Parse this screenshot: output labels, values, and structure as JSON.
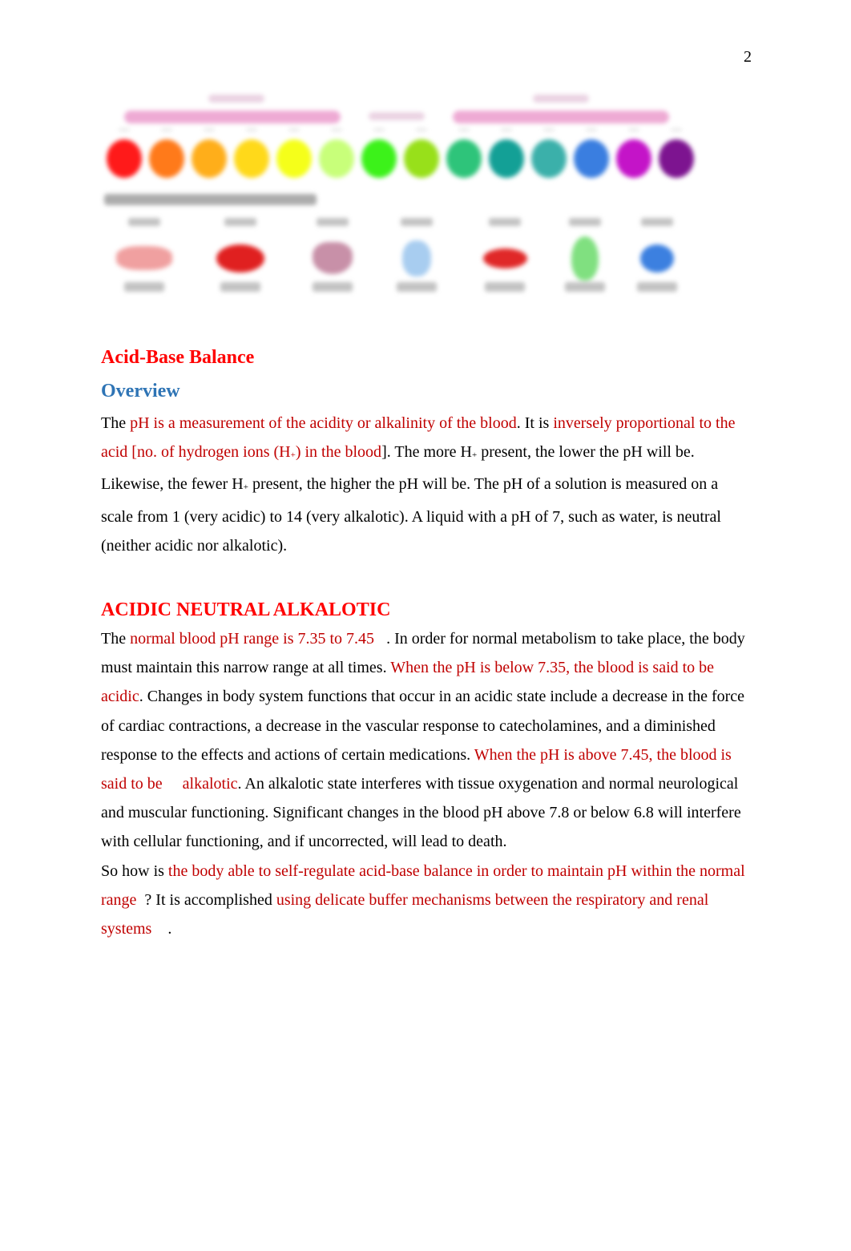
{
  "page_number": "2",
  "figure": {
    "description": "blurred pH scale figure with colored indicator circles and example substances",
    "scale_colors": [
      "#ff1a1a",
      "#ff7a1a",
      "#ffae1a",
      "#ffd91a",
      "#f5ff1a",
      "#c8ff7a",
      "#3cf21a",
      "#98e01a",
      "#2ec47a",
      "#13a096",
      "#3bb0aa",
      "#3a7ee0",
      "#c414c8",
      "#7d1490"
    ],
    "bar_color": "#eeaad4",
    "examples": [
      {
        "color": "#f0a0a0"
      },
      {
        "color": "#e02020"
      },
      {
        "color": "#c890a8"
      },
      {
        "color": "#a8cdf0"
      },
      {
        "color": "#e02828"
      },
      {
        "color": "#80e080"
      },
      {
        "color": "#3c80e0"
      }
    ]
  },
  "heading": "Acid-Base Balance",
  "subheading": "Overview",
  "overview": {
    "s1": "The ",
    "s2": "pH is a measurement of the acidity or alkalinity of the blood",
    "s3": ". It is ",
    "s4": "inversely proportional to the acid [no. of hydrogen ions (H",
    "s4b": "+",
    "s4c": ") in the blood",
    "s5": "]. The more H",
    "s5b": "+",
    "s5c": " present, the lower the pH will be. Likewise, the fewer H",
    "s5d": "+",
    "s5e": " present, the higher the pH will be. The pH of a solution is measured on a scale from 1 (very acidic) to 14 (very alkalotic). A liquid with a pH of 7, such as water, is neutral (neither acidic nor alkalotic)."
  },
  "section_heading": "ACIDIC NEUTRAL ALKALOTIC",
  "body": {
    "s1": "The ",
    "s2": "normal blood pH range is 7.35 to 7.45",
    "s3": "   . In order for normal metabolism to take place, the body must maintain this narrow range at all times. ",
    "s4": "When the pH is below 7.35, the blood is said to be  acidic",
    "s5": ". Changes in body system functions that occur in an acidic state include a decrease in the force of cardiac contractions, a decrease in the vascular response to catecholamines, and a diminished response to the effects and actions of certain medications.",
    "s6": "When the pH is above 7.45, the blood is said to be     alkalotic",
    "s7": ". An alkalotic state interferes with tissue oxygenation and normal neurological and muscular functioning. Significant changes in the blood pH above 7.8 or below 6.8 will interfere with cellular functioning, and if uncorrected, will lead to death.",
    "s8": "So how is ",
    "s9": "the body able to self-regulate acid-base balance in order to maintain pH within the normal range",
    "s10": "  ? It is accomplished ",
    "s11": "using delicate buffer mechanisms between the respiratory and renal systems",
    "s12": "    ."
  }
}
